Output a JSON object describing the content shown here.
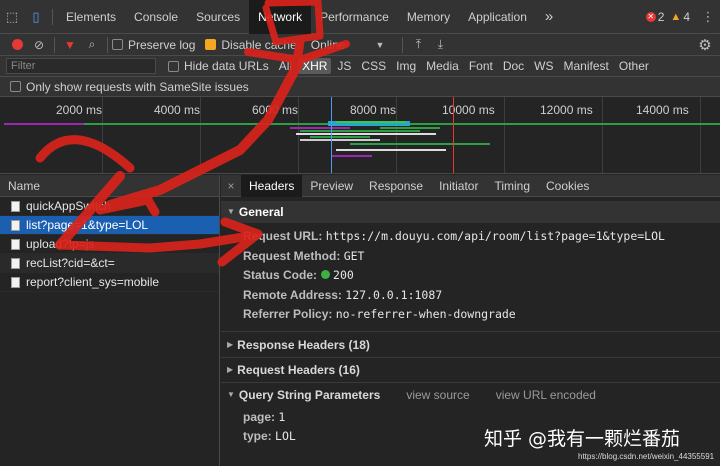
{
  "tabbar": {
    "tabs": [
      "Elements",
      "Console",
      "Sources",
      "Network",
      "Performance",
      "Memory",
      "Application"
    ],
    "active": "Network",
    "more_label": "»",
    "errors": "2",
    "warnings": "4"
  },
  "toolbar": {
    "preserve_log": "Preserve log",
    "disable_cache": "Disable cache",
    "throttle": "Online"
  },
  "filterbar": {
    "placeholder": "Filter",
    "hide_data_urls": "Hide data URLs",
    "types": [
      "All",
      "XHR",
      "JS",
      "CSS",
      "Img",
      "Media",
      "Font",
      "Doc",
      "WS",
      "Manifest",
      "Other"
    ],
    "active_type": "XHR"
  },
  "samesite": {
    "label": "Only show requests with SameSite issues"
  },
  "timeline": {
    "ticks": [
      "2000 ms",
      "4000 ms",
      "6000 ms",
      "8000 ms",
      "10000 ms",
      "12000 ms",
      "14000 ms"
    ]
  },
  "requests": {
    "header": "Name",
    "items": [
      "quickAppSwitch",
      "list?page=1&type=LOL",
      "upload?tp=js",
      "recList?cid=&ct=",
      "report?client_sys=mobile"
    ],
    "selected_index": 1
  },
  "details": {
    "close": "×",
    "tabs": [
      "Headers",
      "Preview",
      "Response",
      "Initiator",
      "Timing",
      "Cookies"
    ],
    "active": "Headers",
    "general": {
      "title": "General",
      "rows": [
        {
          "k": "Request URL:",
          "v": "https://m.douyu.com/api/room/list?page=1&type=LOL"
        },
        {
          "k": "Request Method:",
          "v": "GET"
        },
        {
          "k": "Status Code:",
          "v": "200"
        },
        {
          "k": "Remote Address:",
          "v": "127.0.0.1:1087"
        },
        {
          "k": "Referrer Policy:",
          "v": "no-referrer-when-downgrade"
        }
      ]
    },
    "response_headers": "Response Headers (18)",
    "request_headers": "Request Headers (16)",
    "query": {
      "title": "Query String Parameters",
      "view_source": "view source",
      "view_encoded": "view URL encoded",
      "rows": [
        {
          "k": "page:",
          "v": "1"
        },
        {
          "k": "type:",
          "v": "LOL"
        }
      ]
    }
  },
  "watermark": {
    "text": "知乎 @我有一颗烂番茄",
    "url": "https://blog.csdn.net/weixin_44355591"
  },
  "colors": {
    "accent_blue": "#1b5fb0",
    "status_green": "#3cb043",
    "record_red": "#e53935",
    "annotation_red": "#d9231b"
  }
}
